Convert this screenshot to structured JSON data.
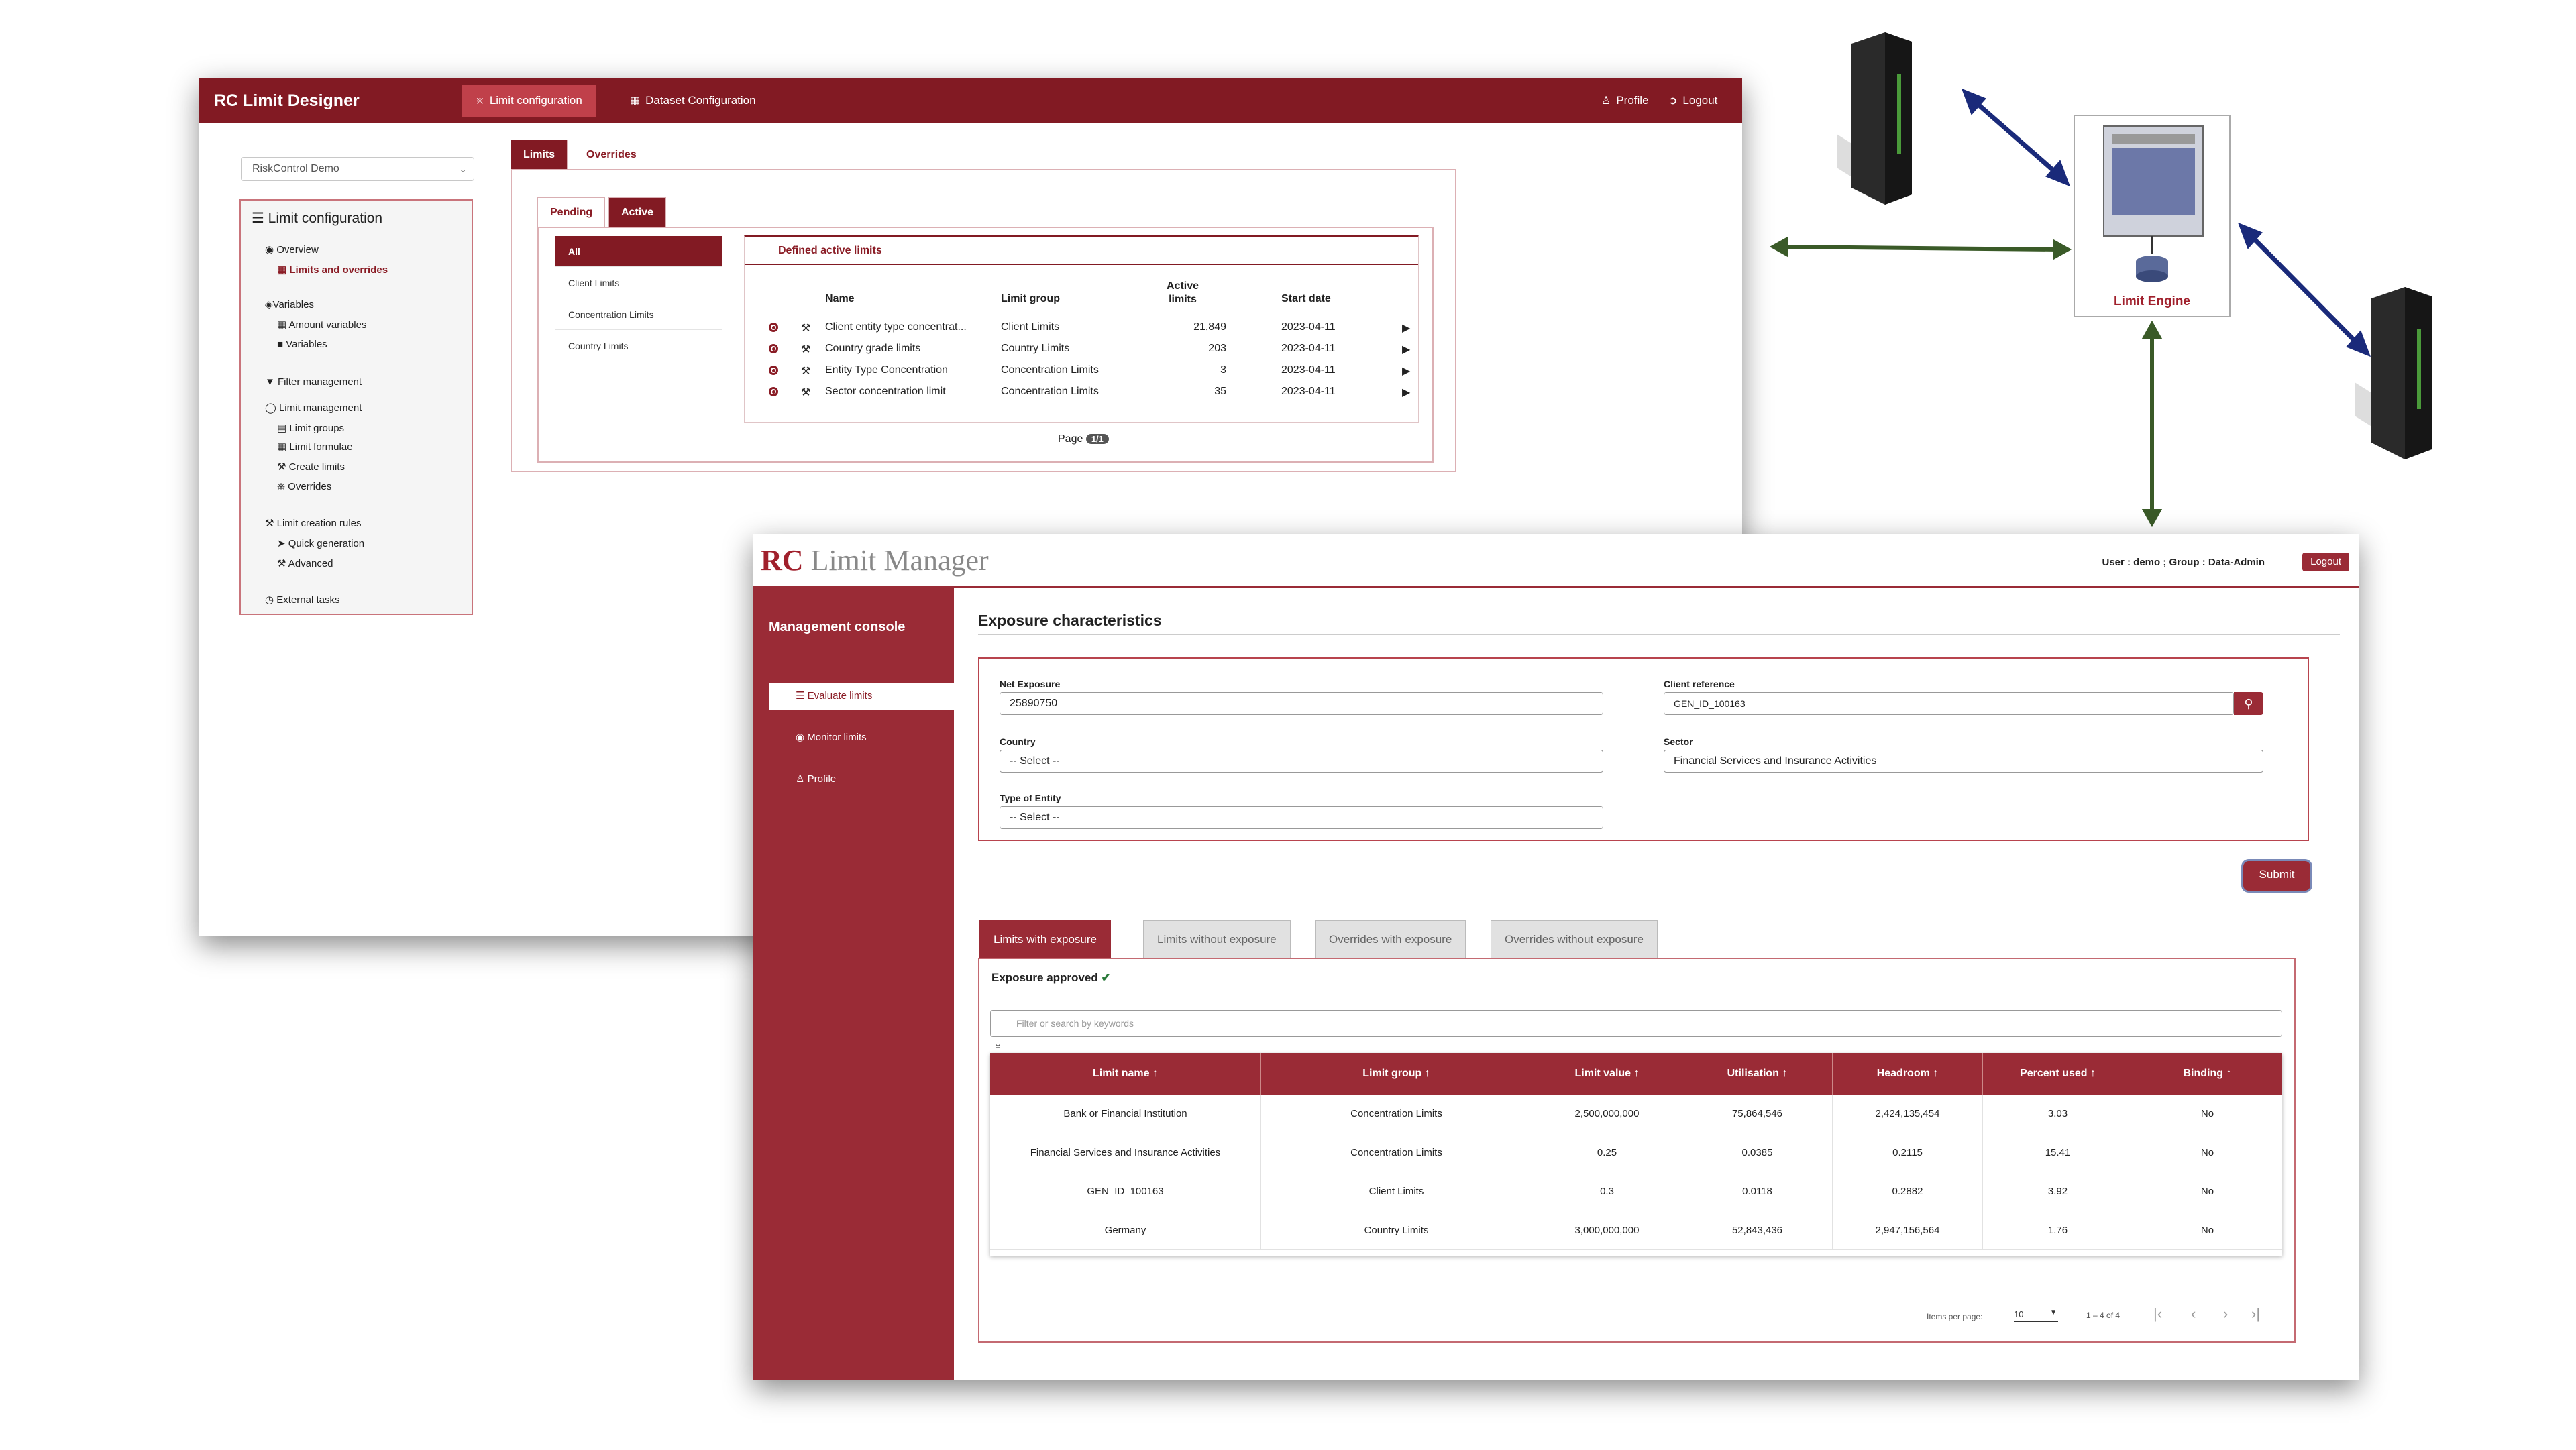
{
  "designer": {
    "brand": "RC Limit Designer",
    "nav": {
      "limit_config": "Limit configuration",
      "dataset_config": "Dataset Configuration",
      "profile": "Profile",
      "logout": "Logout"
    },
    "environment": "RiskControl Demo",
    "panel_title": "Limit configuration",
    "tree": [
      "Overview",
      "Limits and overrides",
      "Variables",
      "Amount variables",
      "Variables",
      "Filter management",
      "Limit management",
      "Limit groups",
      "Limit formulae",
      "Create limits",
      "Overrides",
      "Limit creation rules",
      "Quick generation",
      "Advanced",
      "External tasks"
    ],
    "tabs": [
      "Limits",
      "Overrides"
    ],
    "subtabs": [
      "Pending",
      "Active"
    ],
    "filters": [
      "All",
      "Client Limits",
      "Concentration Limits",
      "Country Limits"
    ],
    "section_title": "Defined active limits",
    "columns": [
      "Name",
      "Limit group",
      "Active limits",
      "Start date"
    ],
    "rows": [
      {
        "name": "Client entity type concentrat...",
        "group": "Client Limits",
        "active": "21,849",
        "date": "2023-04-11"
      },
      {
        "name": "Country grade limits",
        "group": "Country Limits",
        "active": "203",
        "date": "2023-04-11"
      },
      {
        "name": "Entity Type Concentration",
        "group": "Concentration Limits",
        "active": "3",
        "date": "2023-04-11"
      },
      {
        "name": "Sector concentration limit",
        "group": "Concentration Limits",
        "active": "35",
        "date": "2023-04-11"
      }
    ],
    "page_label": "Page",
    "page_value": "1/1"
  },
  "diagram": {
    "engine_label": "Limit Engine",
    "colors": {
      "blue": "#1a2a7a",
      "green": "#3a5a28"
    }
  },
  "manager": {
    "brand_rc": "RC",
    "brand_name": "Limit Manager",
    "user_info": "User : demo ;  Group : Data-Admin",
    "logout": "Logout",
    "console_title": "Management console",
    "side_items": [
      "Evaluate limits",
      "Monitor limits",
      "Profile"
    ],
    "section_title": "Exposure characteristics",
    "form": {
      "net_exposure_label": "Net Exposure",
      "net_exposure": "25890750",
      "client_ref_label": "Client reference",
      "client_ref": "GEN_ID_100163",
      "country_label": "Country",
      "country": "-- Select --",
      "sector_label": "Sector",
      "sector": "Financial Services and Insurance Activities",
      "entity_label": "Type of Entity",
      "entity": "-- Select --"
    },
    "submit": "Submit",
    "tabs": [
      "Limits with exposure",
      "Limits without exposure",
      "Overrides with exposure",
      "Overrides without exposure"
    ],
    "approved": "Exposure approved",
    "filter_placeholder": "Filter or search by keywords",
    "columns": [
      "Limit name ↑",
      "Limit group ↑",
      "Limit value ↑",
      "Utilisation ↑",
      "Headroom ↑",
      "Percent used ↑",
      "Binding ↑"
    ],
    "rows": [
      [
        "Bank or Financial Institution",
        "Concentration Limits",
        "2,500,000,000",
        "75,864,546",
        "2,424,135,454",
        "3.03",
        "No"
      ],
      [
        "Financial Services and Insurance Activities",
        "Concentration Limits",
        "0.25",
        "0.0385",
        "0.2115",
        "15.41",
        "No"
      ],
      [
        "GEN_ID_100163",
        "Client Limits",
        "0.3",
        "0.0118",
        "0.2882",
        "3.92",
        "No"
      ],
      [
        "Germany",
        "Country Limits",
        "3,000,000,000",
        "52,843,436",
        "2,947,156,564",
        "1.76",
        "No"
      ]
    ],
    "paginator": {
      "items_label": "Items per page:",
      "items_value": "10",
      "range": "1 – 4 of 4"
    },
    "colors": {
      "accent": "#9a2b36",
      "header": "#821a23"
    }
  }
}
